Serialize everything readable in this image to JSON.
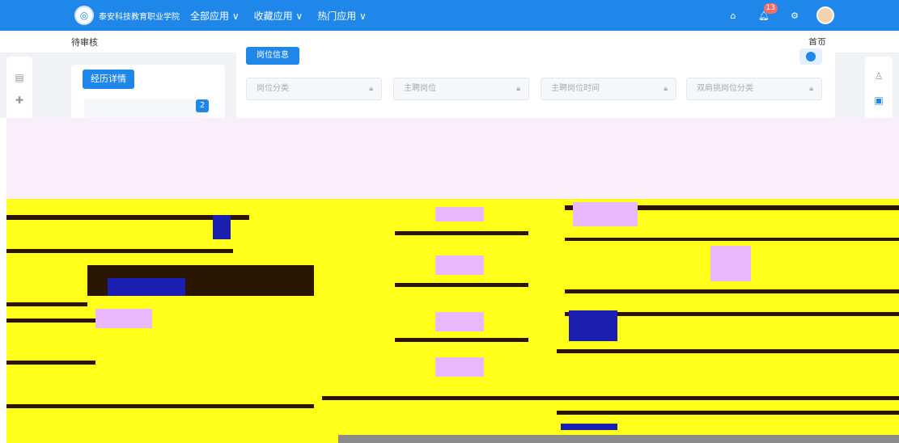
{
  "topbar": {
    "logo_text": "泰安科技教育职业学院",
    "nav": [
      "全部应用 ∨",
      "收藏应用 ∨",
      "热门应用 ∨"
    ],
    "notification_count": "13"
  },
  "breadcrumb": {
    "left": "待审核",
    "right": "首页"
  },
  "sidebar": {
    "detail_button": "经历详情",
    "count": "2"
  },
  "content": {
    "tag_button": "岗位信息",
    "fields": [
      "岗位分类",
      "主聘岗位",
      "主聘岗位时间",
      "双肩挑岗位分类"
    ]
  },
  "colors": {
    "primary": "#1f86ea",
    "overlay_yellow": "#ffff1a",
    "overlay_pink": "#fbeefb"
  }
}
